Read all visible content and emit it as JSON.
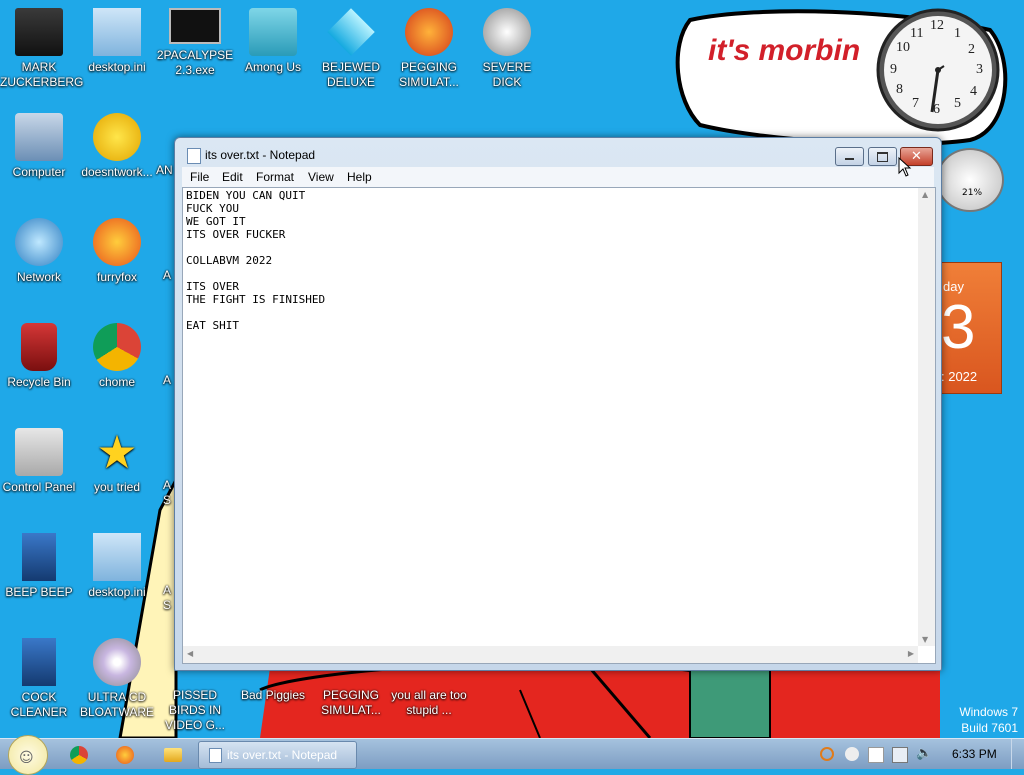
{
  "desktop": {
    "icons": [
      {
        "label": "MARK ZUCKERBERG"
      },
      {
        "label": "desktop.ini"
      },
      {
        "label": "2PACALYPSE 2.3.exe"
      },
      {
        "label": "Among Us"
      },
      {
        "label": "BEJEWED DELUXE"
      },
      {
        "label": "PEGGING SIMULAT..."
      },
      {
        "label": "SEVERE DICK"
      },
      {
        "label": "Computer"
      },
      {
        "label": "doesntwork..."
      },
      {
        "label": "Network"
      },
      {
        "label": "furryfox"
      },
      {
        "label": "Recycle Bin"
      },
      {
        "label": "chome"
      },
      {
        "label": "Control Panel"
      },
      {
        "label": "you tried"
      },
      {
        "label": "BEEP BEEP"
      },
      {
        "label": "desktop.ini"
      },
      {
        "label": "COCK CLEANER"
      },
      {
        "label": "ULTRA CD BLOATWARE"
      },
      {
        "label": "PISSED BIRDS IN VIDEO G..."
      },
      {
        "label": "Bad Piggies"
      },
      {
        "label": "PEGGING SIMULAT..."
      },
      {
        "label": "you all are too stupid ..."
      }
    ],
    "partial_labels": [
      "AN",
      "A",
      "A",
      "A",
      "A S",
      "A S"
    ]
  },
  "wallpaper": {
    "banner_text": "it's morbin",
    "calendar": {
      "weekday_fragment": "day",
      "date_number": "3",
      "year_fragment": ": 2022"
    },
    "cpu_meter": "21%"
  },
  "clock_gadget": {
    "numbers": [
      "12",
      "1",
      "2",
      "3",
      "4",
      "5",
      "6",
      "7",
      "8",
      "9",
      "10",
      "11"
    ]
  },
  "notepad": {
    "title": "its over.txt - Notepad",
    "menu": [
      "File",
      "Edit",
      "Format",
      "View",
      "Help"
    ],
    "content": "BIDEN YOU CAN QUIT\nFUCK YOU\nWE GOT IT\nITS OVER FUCKER\n\nCOLLABVM 2022\n\nITS OVER\nTHE FIGHT IS FINISHED\n\nEAT SHIT"
  },
  "watermark": {
    "line1": "Windows 7",
    "line2": "Build 7601"
  },
  "taskbar": {
    "task_label": "its over.txt - Notepad",
    "time": "6:33 PM"
  },
  "colors": {
    "desktop": "#1fa8e8",
    "red_figure": "#e4261f",
    "close_button": "#c4402a"
  }
}
